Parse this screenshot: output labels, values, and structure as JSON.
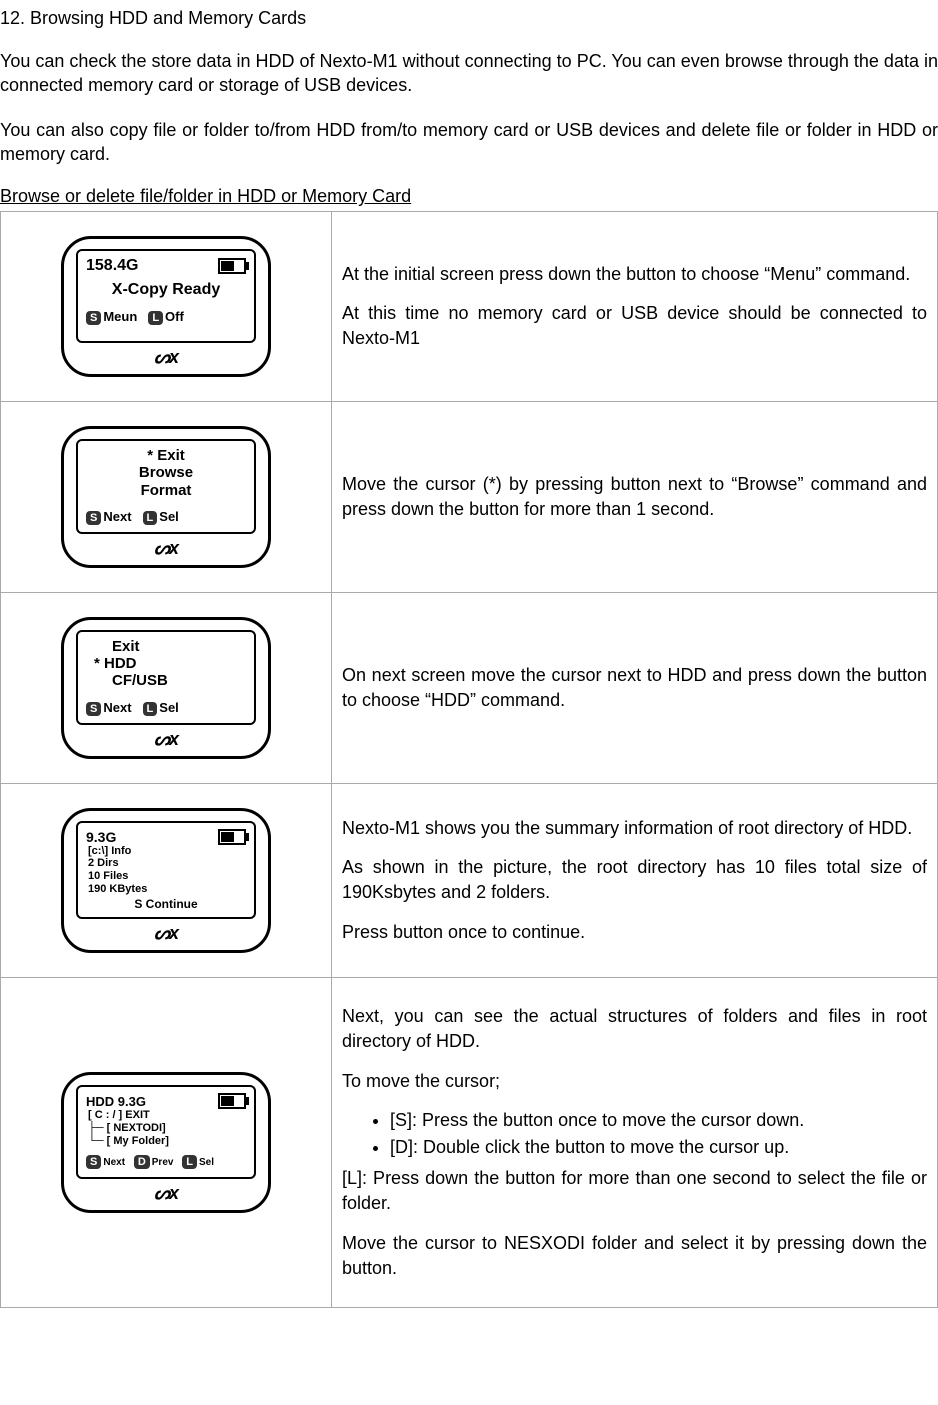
{
  "title": "12. Browsing HDD and Memory Cards",
  "intro1": "You can check the store data in HDD of Nexto-M1 without connecting to PC. You can even browse through the data in connected memory card or storage of USB devices.",
  "intro2": "You can also copy file or folder to/from HDD from/to memory card or USB devices and delete file or folder in HDD or memory card.",
  "subheader": "Browse or delete file/folder in HDD or Memory Card",
  "logo": "ᔕx",
  "badges": {
    "S": "S",
    "L": "L",
    "D": "D"
  },
  "row1": {
    "storage": "158.4G",
    "ready": "X-Copy Ready",
    "bS": "Meun",
    "bL": "Off",
    "text1": "At the initial screen press down the button to choose “Menu” command.",
    "text2": "At this time no memory card or USB device should be connected to Nexto-M1"
  },
  "row2": {
    "m1": "*   Exit",
    "m2": "Browse",
    "m3": "Format",
    "bS": "Next",
    "bL": "Sel",
    "text": "Move the cursor (*) by pressing button next to “Browse” command and press down the button for more than 1 second."
  },
  "row3": {
    "m1": "Exit",
    "m2": "* HDD",
    "m3": "CF/USB",
    "bS": "Next",
    "bL": "Sel",
    "text": "On next screen move the cursor next to HDD and press down the button to choose “HDD” command."
  },
  "row4": {
    "storage": "9.3G",
    "l1": "[c:\\]  Info",
    "l2": "2       Dirs",
    "l3": "10    Files",
    "l4": "190  KBytes",
    "bS": "S Continue",
    "text1": "Nexto-M1 shows you the summary information of root directory of HDD.",
    "text2": "As shown in the picture, the root directory has 10 files total size of 190Ksbytes and 2 folders.",
    "text3": "Press button once to continue."
  },
  "row5": {
    "header": "HDD  9.3G",
    "l1": "[ C : / ]          EXIT",
    "l2": "├─ [ NEXTODI]",
    "l3": "└─ [ My Folder]",
    "bS": "Next",
    "bD": "Prev",
    "bL": "Sel",
    "text1": "Next, you can see the actual structures of folders and files in root directory of HDD.",
    "text2": "To move the cursor;",
    "b1": "[S]: Press the button once to move the cursor down.",
    "b2": "[D]: Double click the button to move the cursor up.",
    "text3": "[L]: Press down the button for more than one second to select the file or folder.",
    "text4": "Move the cursor to NESXODI folder and select it by pressing down the button."
  }
}
